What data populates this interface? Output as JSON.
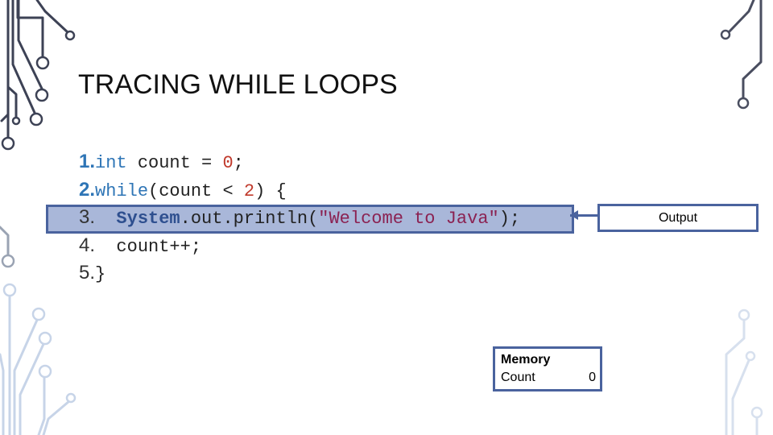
{
  "slide": {
    "title": "TRACING WHILE LOOPS",
    "code_lines": [
      {
        "number": "1.",
        "indent": "",
        "tokens": [
          {
            "t": "int",
            "c": "kw"
          },
          {
            "t": " count = ",
            "c": ""
          },
          {
            "t": "0",
            "c": "lit"
          },
          {
            "t": ";",
            "c": ""
          }
        ]
      },
      {
        "number": "2.",
        "indent": "",
        "tokens": [
          {
            "t": "while",
            "c": "kw"
          },
          {
            "t": "(count < ",
            "c": ""
          },
          {
            "t": "2",
            "c": "lit"
          },
          {
            "t": ") {",
            "c": ""
          }
        ]
      },
      {
        "number": "3.",
        "indent": "  ",
        "tokens": [
          {
            "t": "System",
            "c": "kwb"
          },
          {
            "t": ".out.println(",
            "c": ""
          },
          {
            "t": "\"Welcome to Java\"",
            "c": "str"
          },
          {
            "t": ");",
            "c": ""
          }
        ]
      },
      {
        "number": "4.",
        "indent": "  ",
        "tokens": [
          {
            "t": "count++;",
            "c": ""
          }
        ]
      },
      {
        "number": "5.",
        "indent": "",
        "tokens": [
          {
            "t": "}",
            "c": ""
          }
        ]
      }
    ],
    "highlighted_line": 3,
    "output": {
      "label": "Output",
      "value": ""
    },
    "memory": {
      "title": "Memory",
      "variables": [
        {
          "name": "Count",
          "value": "0"
        }
      ]
    },
    "colors": {
      "accent": "#2e75b6",
      "highlight_fill": "#a9b7d9",
      "highlight_border": "#4a639e",
      "circuit_dark": "#3d4255",
      "circuit_light": "#c7d4e8"
    }
  }
}
